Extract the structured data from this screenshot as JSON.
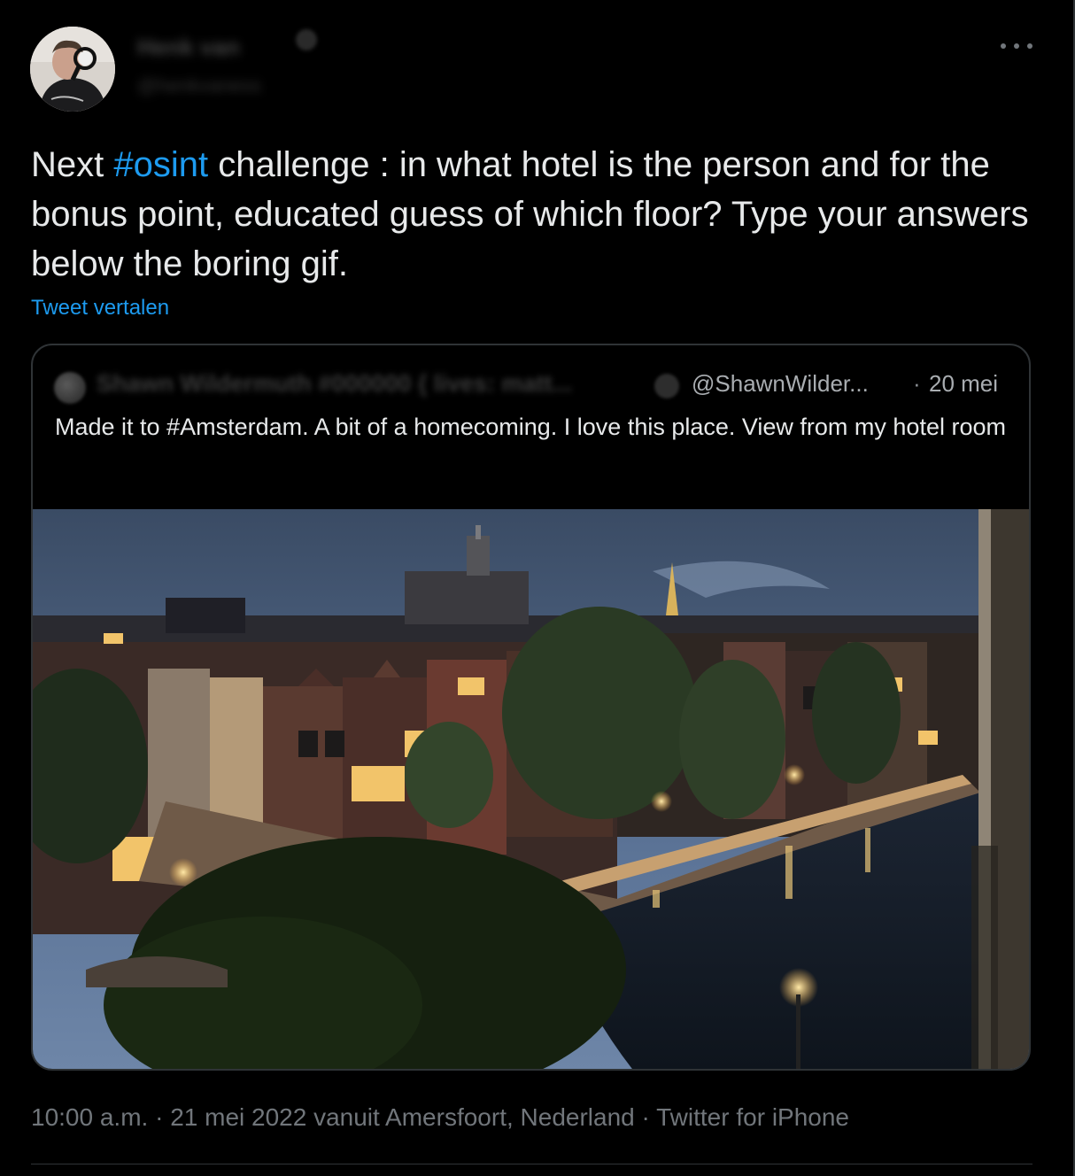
{
  "author": {
    "name": "Henk van",
    "handle": "@henkvaness"
  },
  "tweet": {
    "text_prefix": "Next ",
    "hashtag": "#osint",
    "text_suffix": " challenge : in what hotel is the person and for the bonus point, educated guess of which floor? Type your answers below the boring gif.",
    "translate_label": "Tweet vertalen"
  },
  "quote": {
    "name": "Shawn Wildermuth #000000 { lives: matt...",
    "handle": "@ShawnWilder...",
    "dot": "·",
    "date": "20 mei",
    "text": "Made it to #Amsterdam. A bit of a homecoming. I love this place. View from my hotel room"
  },
  "footer": {
    "time": "10:00 a.m.",
    "sep1": " · ",
    "date_location": "21 mei 2022 vanuit Amersfoort, Nederland",
    "sep2": " · ",
    "client": "Twitter for iPhone"
  },
  "icons": {
    "more": "more-horizontal-icon",
    "verified": "verified-badge-icon"
  },
  "colors": {
    "background": "#000000",
    "text": "#e7e9ea",
    "link": "#1d9bf0",
    "secondary": "#71767b",
    "border": "#2f3336"
  }
}
